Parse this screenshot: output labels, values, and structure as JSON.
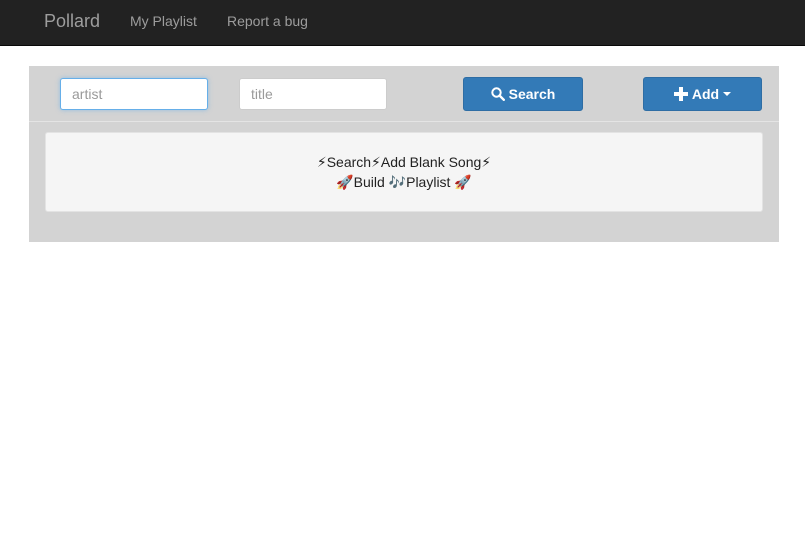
{
  "navbar": {
    "brand": "Pollard",
    "links": [
      "My Playlist",
      "Report a bug"
    ]
  },
  "search": {
    "artist_placeholder": "artist",
    "artist_value": "",
    "title_placeholder": "title",
    "title_value": "",
    "search_label": "Search",
    "search_icon": "search-icon",
    "add_label": "Add",
    "add_icon": "plus-icon"
  },
  "instructions": {
    "line1": "⚡Search⚡Add Blank Song⚡",
    "line2": "🚀Build 🎶Playlist 🚀"
  },
  "colors": {
    "navbar_bg": "#222222",
    "panel_bg": "#d3d3d3",
    "primary": "#337ab7",
    "focus": "#66afe9"
  }
}
